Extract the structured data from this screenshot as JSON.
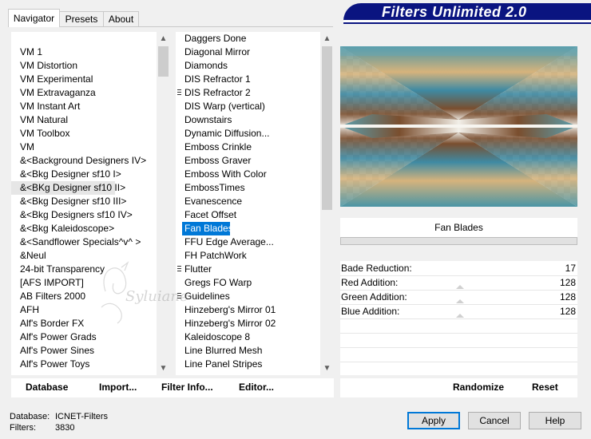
{
  "tabs": [
    {
      "label": "Navigator",
      "active": true
    },
    {
      "label": "Presets",
      "active": false
    },
    {
      "label": "About",
      "active": false
    }
  ],
  "banner": {
    "title": "Filters Unlimited 2.0"
  },
  "categories": [
    {
      "label": "VM 1"
    },
    {
      "label": "VM Distortion"
    },
    {
      "label": "VM Experimental"
    },
    {
      "label": "VM Extravaganza"
    },
    {
      "label": "VM Instant Art"
    },
    {
      "label": "VM Natural"
    },
    {
      "label": "VM Toolbox"
    },
    {
      "label": "VM"
    },
    {
      "label": "&<Background Designers IV>"
    },
    {
      "label": "&<Bkg Designer sf10 I>"
    },
    {
      "label": "&<BKg Designer sf10 II>",
      "highlighted": true
    },
    {
      "label": "&<Bkg Designer sf10 III>"
    },
    {
      "label": "&<Bkg Designers sf10 IV>"
    },
    {
      "label": "&<Bkg Kaleidoscope>"
    },
    {
      "label": "&<Sandflower Specials^v^ >"
    },
    {
      "label": "&Neul"
    },
    {
      "label": "24-bit Transparency"
    },
    {
      "label": "[AFS IMPORT]"
    },
    {
      "label": "AB Filters 2000"
    },
    {
      "label": "AFH"
    },
    {
      "label": "Alf's Border FX"
    },
    {
      "label": "Alf's Power Grads"
    },
    {
      "label": "Alf's Power Sines"
    },
    {
      "label": "Alf's Power Toys"
    }
  ],
  "filters": [
    {
      "label": "Daggers Done"
    },
    {
      "label": "Diagonal Mirror"
    },
    {
      "label": "Diamonds"
    },
    {
      "label": "DIS Refractor 1"
    },
    {
      "label": "DIS Refractor 2",
      "marked": true
    },
    {
      "label": "DIS Warp (vertical)"
    },
    {
      "label": "Downstairs"
    },
    {
      "label": "Dynamic Diffusion..."
    },
    {
      "label": "Emboss Crinkle"
    },
    {
      "label": "Emboss Graver"
    },
    {
      "label": "Emboss With Color"
    },
    {
      "label": "EmbossTimes"
    },
    {
      "label": "Evanescence"
    },
    {
      "label": "Facet Offset"
    },
    {
      "label": "Fan Blades",
      "selected": true
    },
    {
      "label": "FFU Edge Average..."
    },
    {
      "label": "FH PatchWork"
    },
    {
      "label": "Flutter",
      "marked": true
    },
    {
      "label": "Gregs FO Warp"
    },
    {
      "label": "Guidelines",
      "marked": true
    },
    {
      "label": "Hinzeberg's Mirror 01"
    },
    {
      "label": "Hinzeberg's Mirror 02"
    },
    {
      "label": "Kaleidoscope 8"
    },
    {
      "label": "Line Blurred Mesh"
    },
    {
      "label": "Line Panel Stripes"
    }
  ],
  "selected_filter": "Fan Blades",
  "params": [
    {
      "label": "Bade Reduction:",
      "value": "17"
    },
    {
      "label": "Red Addition:",
      "value": "128"
    },
    {
      "label": "Green Addition:",
      "value": "128"
    },
    {
      "label": "Blue Addition:",
      "value": "128"
    }
  ],
  "left_buttons": [
    {
      "label": "Database"
    },
    {
      "label": "Import..."
    },
    {
      "label": "Filter Info..."
    },
    {
      "label": "Editor..."
    }
  ],
  "right_buttons": [
    {
      "label": "Randomize"
    },
    {
      "label": "Reset"
    }
  ],
  "info": {
    "database_label": "Database:",
    "database_value": "ICNET-Filters",
    "filters_label": "Filters:",
    "filters_value": "3830"
  },
  "dialog_buttons": {
    "apply": "Apply",
    "cancel": "Cancel",
    "help": "Help"
  },
  "watermark_text": "Syluiane",
  "colors": {
    "banner": "#0a1480",
    "selection": "#0078d7",
    "default_border": "#0078d7"
  },
  "icons": {
    "scroll_up": "▲",
    "scroll_down": "▼"
  }
}
